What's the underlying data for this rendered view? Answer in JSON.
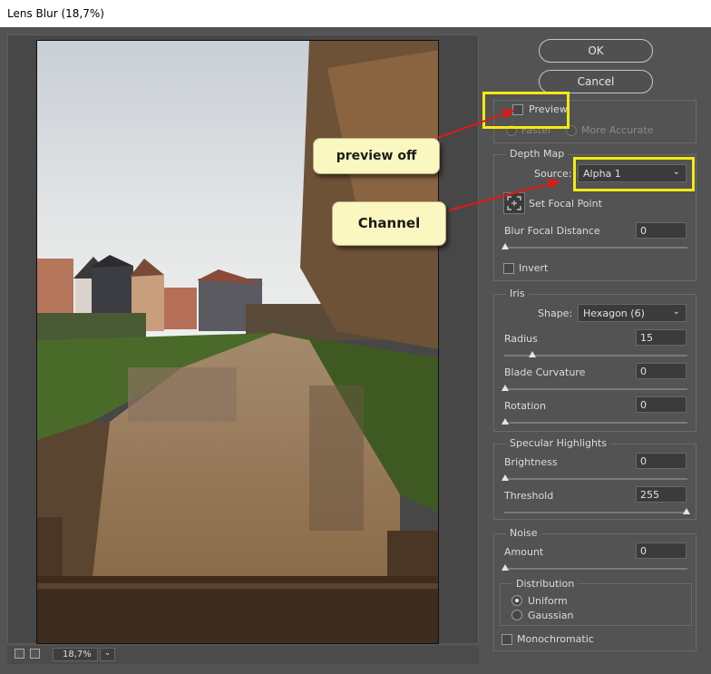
{
  "window": {
    "title": "Lens Blur (18,7%)"
  },
  "zoom": "18,7%",
  "buttons": {
    "ok": "OK",
    "cancel": "Cancel"
  },
  "preview": {
    "label": "Preview",
    "checked": false,
    "faster_label": "Faster",
    "more_accurate_label": "More Accurate"
  },
  "depth_map": {
    "title": "Depth Map",
    "source_label": "Source:",
    "source_value": "Alpha 1",
    "set_focal_label": "Set Focal Point",
    "blur_focal_label": "Blur Focal Distance",
    "blur_focal_value": "0",
    "invert_label": "Invert"
  },
  "iris": {
    "title": "Iris",
    "shape_label": "Shape:",
    "shape_value": "Hexagon (6)",
    "radius_label": "Radius",
    "radius_value": "15",
    "blade_label": "Blade Curvature",
    "blade_value": "0",
    "rotation_label": "Rotation",
    "rotation_value": "0"
  },
  "specular": {
    "title": "Specular Highlights",
    "brightness_label": "Brightness",
    "brightness_value": "0",
    "threshold_label": "Threshold",
    "threshold_value": "255"
  },
  "noise": {
    "title": "Noise",
    "amount_label": "Amount",
    "amount_value": "0",
    "distribution_title": "Distribution",
    "uniform_label": "Uniform",
    "gaussian_label": "Gaussian",
    "monochromatic_label": "Monochromatic"
  },
  "annotations": {
    "preview_off": "preview off",
    "channel": "Channel",
    "highlight_color": "#f2ea13",
    "arrow_color": "#e01818"
  }
}
